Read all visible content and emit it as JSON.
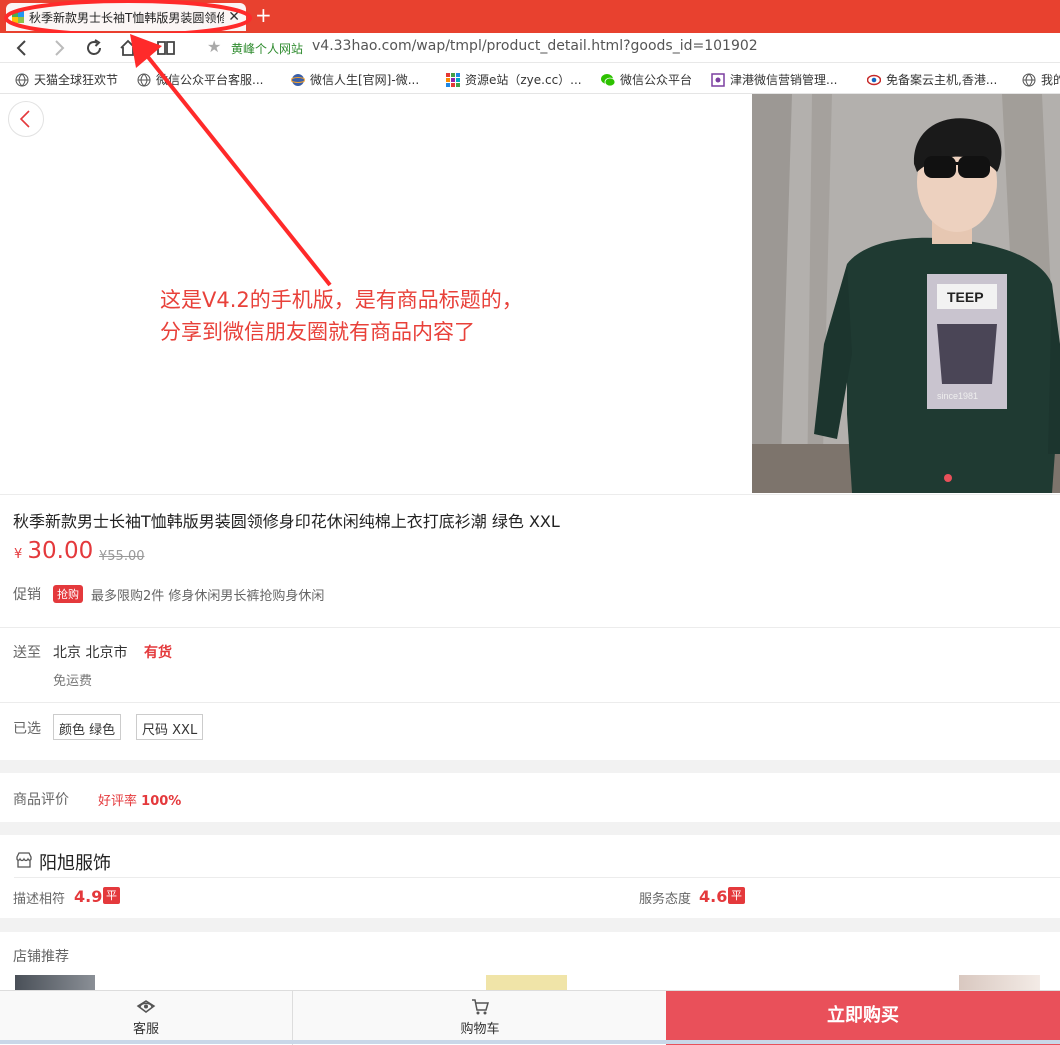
{
  "browser": {
    "tab_title": "秋季新款男士长袖T恤韩版男装圆领修",
    "new_tab_symbol": "+",
    "site_name": "黄峰个人网站",
    "url": "v4.33hao.com/wap/tmpl/product_detail.html?goods_id=101902"
  },
  "bookmarks": [
    {
      "label": "天猫全球狂欢节",
      "icon": "globe-icon"
    },
    {
      "label": "微信公众平台客服...",
      "icon": "globe-icon"
    },
    {
      "label": "微信人生[官网]-微...",
      "icon": "planet-icon"
    },
    {
      "label": "资源e站（zye.cc）...",
      "icon": "grid-icon"
    },
    {
      "label": "微信公众平台",
      "icon": "wechat-icon"
    },
    {
      "label": "津港微信营销管理...",
      "icon": "puzzle-icon"
    },
    {
      "label": "免备案云主机,香港...",
      "icon": "eye-icon"
    },
    {
      "label": "我的",
      "icon": "globe-icon"
    }
  ],
  "annotation": {
    "line1": "这是V4.2的手机版，是有商品标题的，",
    "line2": "分享到微信朋友圈就有商品内容了",
    "color": "#e8413a"
  },
  "product": {
    "title": "秋季新款男士长袖T恤韩版男装圆领修身印花休闲纯棉上衣打底衫潮 绿色 XXL",
    "currency": "¥",
    "price": "30.00",
    "old_price": "¥55.00",
    "promo_label": "促销",
    "promo_tag": "抢购",
    "promo_text": "最多限购2件 修身休闲男长裤抢购身休闲",
    "ship_label": "送至",
    "ship_address": "北京 北京市",
    "stock": "有货",
    "free_shipping": "免运费",
    "selected_label": "已选",
    "options": [
      {
        "label": "颜色 绿色"
      },
      {
        "label": "尺码 XXL"
      }
    ],
    "image_dots": 1
  },
  "reviews": {
    "label": "商品评价",
    "rate_label": "好评率",
    "rate_value": "100%"
  },
  "store": {
    "name": "阳旭服饰",
    "scores": [
      {
        "label": "描述相符",
        "value": "4.9",
        "badge": "平"
      },
      {
        "label": "服务态度",
        "value": "4.6",
        "badge": "平"
      }
    ],
    "recommend_label": "店铺推荐"
  },
  "bottom_bar": {
    "service_label": "客服",
    "cart_label": "购物车",
    "buy_label": "立即购买",
    "buy_color": "#e9505a"
  },
  "colors": {
    "tab_bar": "#e8412f",
    "price_red": "#e4393c"
  }
}
